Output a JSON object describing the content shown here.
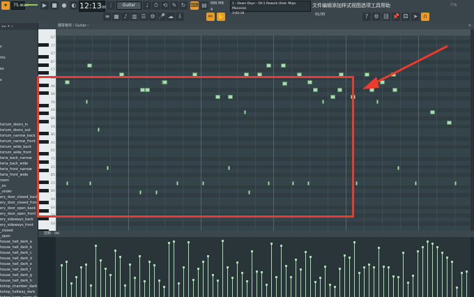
{
  "toolbar": {
    "pattern_name": "75.wav",
    "time": "12:13",
    "time_small": "00",
    "instrument": "Guitar",
    "memory": "686 MB",
    "cpu_small": "4",
    "hint_line1": "1 - Down Days - 59-1 Rework (feat. Maja Manzola)",
    "hint_line2": "3:02:16",
    "counter": "01/35",
    "menu": [
      "文件",
      "编辑",
      "添加",
      "样式",
      "视图",
      "选项",
      "工具",
      "帮助"
    ]
  },
  "piano_roll": {
    "title": "钢琴卷帘 › Guitar ›",
    "key_labels": [
      "G7",
      "F7",
      "E7",
      "D7",
      "C7",
      "B6",
      "A6",
      "G6",
      "F6",
      "E6",
      "D6",
      "C6",
      "B5",
      "A5",
      "G5",
      "F5",
      "E5",
      "D5",
      "C5",
      "B4",
      "A4",
      "G4",
      "F4",
      "E4"
    ],
    "control_label": "控制 · Vel"
  },
  "browser": {
    "items": [
      "",
      "",
      "s",
      "",
      "nts",
      "",
      "es",
      "",
      "s",
      "",
      "",
      "",
      "",
      "",
      "",
      "",
      "torium_doors_in",
      "torium_doors_out",
      "torium_narrow_back",
      "torium_narrow_front",
      "torium_wide_back",
      "torium_wide_front",
      "teria_back_narrow",
      "teria_back_wide",
      "teria_front_narrow",
      "teria_front_wide",
      "room",
      "_on",
      "_under",
      "ery_door_closed_back",
      "ery_door_closed_front",
      "ery_door_open_back",
      "ery_door_open_front",
      "ery_sideways_back",
      "ery_sideways_front",
      "_closed",
      "_open",
      "house_hall_dark_a",
      "house_hall_dark_b",
      "house_hall_dark_c",
      "house_hall_dark_d",
      "house_hall_dark_e",
      "house_hall_dark_f",
      "house_hall_dark_g",
      "house_hall_dark_h",
      "kshop_chamber_dark",
      "kshop_hallway_dark",
      "kshop_large_room_dark",
      "kshop_small_room_dark"
    ]
  },
  "colors": {
    "note": "#a9dcb0",
    "accent": "#e89a2a",
    "highlight": "#ee3a2a"
  }
}
